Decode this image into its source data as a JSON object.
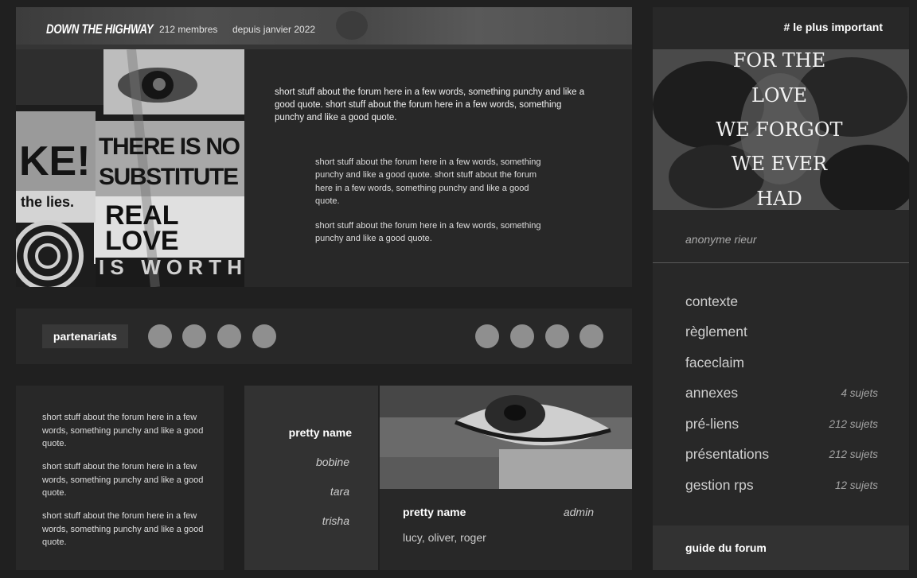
{
  "hero": {
    "title": "DOWN THE HIGHWAY",
    "members": "212 membres",
    "since": "depuis janvier 2022",
    "collage_words": [
      "THERE IS NO",
      "SUBSTITUTE",
      "REAL",
      "LOVE",
      "IS WORTH",
      "the lies.",
      "KE!"
    ],
    "text_1": "short stuff about the forum here in a few words, something punchy and like a good quote. short stuff about the forum here in a few words, something punchy and like a good quote.",
    "text_2": "short stuff about the forum here in a few words, something punchy and like a good quote. short stuff about the forum here in a few words, something punchy and like a good quote.",
    "text_3": "short stuff about the forum here in a few words, something punchy and like a good quote."
  },
  "partners": {
    "label": "partenariats"
  },
  "info": {
    "paragraphs": [
      "short stuff about the forum here in a few words, something punchy and like a good quote.",
      "short stuff about the forum here in a few words, something punchy and like a good quote.",
      "short stuff about the forum here in a few words, something punchy and like a good quote."
    ]
  },
  "names": {
    "title": "pretty name",
    "items": [
      "bobine",
      "tara",
      "trisha"
    ]
  },
  "profile": {
    "title": "pretty name",
    "role": "admin",
    "list": "lucy, oliver, roger"
  },
  "sidebar": {
    "heading": "# le plus important",
    "image_lines": [
      "FOR THE",
      "LOVE",
      "WE FORGOT",
      "WE EVER",
      "HAD"
    ],
    "user": "anonyme rieur",
    "nav": [
      {
        "label": "contexte",
        "count": ""
      },
      {
        "label": "règlement",
        "count": ""
      },
      {
        "label": "faceclaim",
        "count": ""
      },
      {
        "label": "annexes",
        "count": "4 sujets"
      },
      {
        "label": "pré-liens",
        "count": "212 sujets"
      },
      {
        "label": "présentations",
        "count": "212 sujets"
      },
      {
        "label": "gestion rps",
        "count": "12 sujets"
      }
    ],
    "guide": "guide du forum"
  }
}
